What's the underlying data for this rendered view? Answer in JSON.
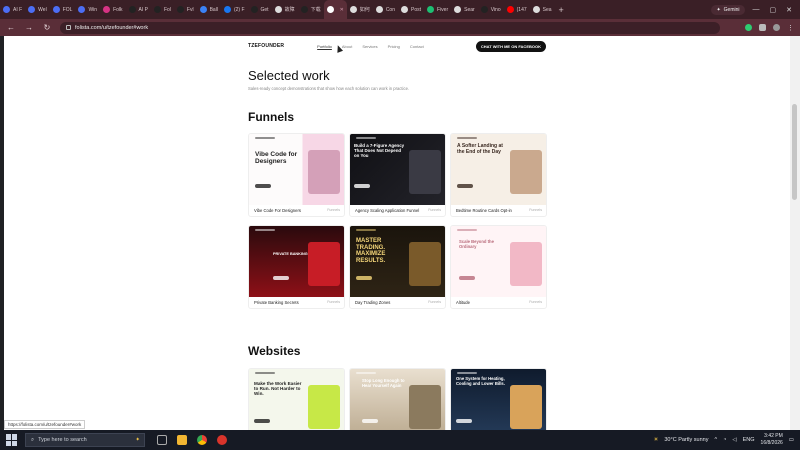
{
  "browser": {
    "tabs": [
      {
        "label": "AI F",
        "color": "#4c6ef5"
      },
      {
        "label": "Wel",
        "color": "#4c6ef5"
      },
      {
        "label": "FOL",
        "color": "#4c6ef5"
      },
      {
        "label": "Win",
        "color": "#4c6ef5"
      },
      {
        "label": "Folk",
        "color": "#d63384"
      },
      {
        "label": "AI P",
        "color": "#222222"
      },
      {
        "label": "Fol",
        "color": "#222222"
      },
      {
        "label": "Fvl",
        "color": "#222222"
      },
      {
        "label": "Ball",
        "color": "#3b82f6"
      },
      {
        "label": "(2) F",
        "color": "#1877f2"
      },
      {
        "label": "Get",
        "color": "#222222"
      },
      {
        "label": "故障",
        "color": "#dddddd"
      },
      {
        "label": "下载",
        "color": "#222222"
      },
      {
        "label": "",
        "color": "#ffffff",
        "active": true
      },
      {
        "label": "如何",
        "color": "#dddddd"
      },
      {
        "label": "Con",
        "color": "#dddddd"
      },
      {
        "label": "Post",
        "color": "#dddddd"
      },
      {
        "label": "Fiver",
        "color": "#1dbf73"
      },
      {
        "label": "Sear",
        "color": "#dddddd"
      },
      {
        "label": "Vino",
        "color": "#222222"
      },
      {
        "label": "(147",
        "color": "#ff0000"
      },
      {
        "label": "Sea",
        "color": "#dddddd"
      }
    ],
    "gemini_label": "Gemini",
    "url": "folista.com/u/tzefounder#work",
    "window_controls": [
      "—",
      "▢",
      "✕"
    ]
  },
  "site": {
    "logo": "TZEFOUNDER",
    "menu": [
      {
        "label": "Portfolio",
        "current": true
      },
      {
        "label": "About"
      },
      {
        "label": "Services"
      },
      {
        "label": "Pricing"
      },
      {
        "label": "Contact"
      }
    ],
    "cta": "CHAT WITH ME ON FACEBOOK"
  },
  "main": {
    "title": "Selected work",
    "subtitle": "Sales-ready concept demonstrations that show how each solution can work in practice.",
    "sections": [
      {
        "heading": "Funnels",
        "cards": [
          {
            "caption": "Vibe Code For Designers",
            "tag": "Funnels",
            "thumb_text": "Vibe Code for Designers",
            "theme": "light-pink"
          },
          {
            "caption": "Agency Scaling Application Funnel",
            "tag": "Funnels",
            "thumb_text": "Build a 7-Figure Agency That Does Not Depend on You",
            "theme": "dark"
          },
          {
            "caption": "Bedtime Routine Cards Opt-in",
            "tag": "Funnels",
            "thumb_text": "A Softer Landing at the End of the Day",
            "theme": "cream"
          },
          {
            "caption": "Private Banking Secrets",
            "tag": "Funnels",
            "thumb_text": "PRIVATE BANKING",
            "theme": "red"
          },
          {
            "caption": "Day Trading Zones",
            "tag": "Funnels",
            "thumb_text": "MASTER TRADING. MAXIMIZE RESULTS.",
            "theme": "gold"
          },
          {
            "caption": "Altitude",
            "tag": "Funnels",
            "thumb_text": "Scale Beyond the Ordinary",
            "theme": "petal"
          }
        ]
      },
      {
        "heading": "Websites",
        "cards": [
          {
            "caption": "",
            "tag": "",
            "thumb_text": "Make the Work Easier to Run. Not Harder to Win.",
            "theme": "lime"
          },
          {
            "caption": "",
            "tag": "",
            "thumb_text": "Stop Long Enough to Hear Yourself Again",
            "theme": "sepia"
          },
          {
            "caption": "",
            "tag": "",
            "thumb_text": "One System for Heating, Cooling and Lower Bills.",
            "theme": "navy"
          }
        ]
      }
    ]
  },
  "status_link": "https://folista.com/u/tzefounder#work",
  "taskbar": {
    "search_placeholder": "Type here to search",
    "weather": "30°C  Partly sunny",
    "lang": "ENG",
    "time": "3:42 PM",
    "date": "16/8/2026"
  }
}
